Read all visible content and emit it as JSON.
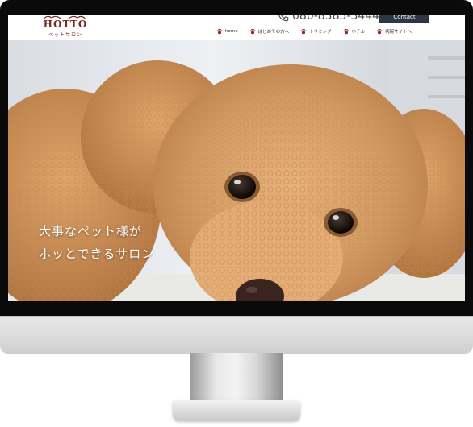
{
  "site": {
    "logo_text": "HOTTO",
    "logo_sub": "ペットサロン",
    "phone": "080-8585-3444",
    "contact_label": "Contact"
  },
  "nav": {
    "items": [
      {
        "label": "home"
      },
      {
        "label": "はじめての方へ"
      },
      {
        "label": "トリミング"
      },
      {
        "label": "ホテル"
      },
      {
        "label": "病院サイトへ"
      }
    ]
  },
  "hero": {
    "line1": "大事なペット様が",
    "line2": "ホッとできるサロン"
  },
  "colors": {
    "brand": "#7b2a20",
    "contact_bg": "#2c3646",
    "paw": "#8b2a1e"
  },
  "icons": {
    "phone": "phone-icon",
    "nav": "paw-icon"
  }
}
